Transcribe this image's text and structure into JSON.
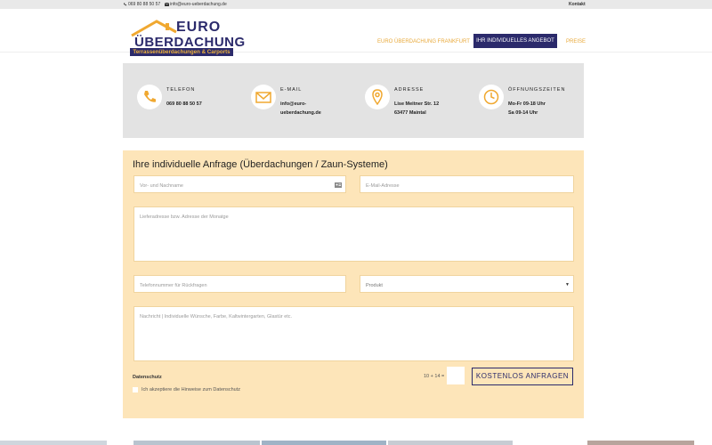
{
  "topbar": {
    "phone": "069 80 88 50 57",
    "email": "info@euro-ueberdachung.de",
    "contact_link": "Kontakt"
  },
  "logo": {
    "line1": "EURO",
    "line2": "ÜBERDACHUNG",
    "tagline": "Terrassenüberdachungen & Carports"
  },
  "nav": {
    "item1": "EURO ÜBERDACHUNG FRANKFURT",
    "item2": "IHR INDIVIDUELLES ANGEBOT",
    "item3": "PREISE"
  },
  "contact": {
    "phone_title": "TELEFON",
    "phone_value": "069 80 88 50 57",
    "email_title": "E-MAIL",
    "email_line1": "info@euro-",
    "email_line2": "ueberdachung.de",
    "address_title": "ADRESSE",
    "address_line1": "Lise Meitner Str. 12",
    "address_line2": "63477 Maintal",
    "hours_title": "ÖFFNUNGSZEITEN",
    "hours_line1": "Mo-Fr 09-18 Uhr",
    "hours_line2": "Sa 09-14 Uhr"
  },
  "form": {
    "title": "Ihre individuelle Anfrage (Überdachungen / Zaun-Systeme)",
    "name_placeholder": "Vor- und Nachname",
    "email_placeholder": "E-Mail-Adresse",
    "address_placeholder": "Lieferadresse bzw. Adresse der Monatge",
    "phone_placeholder": "Telefonnummer für Rückfragen",
    "product_selected": "Produkt",
    "message_placeholder": "Nachricht | Individuelle Wünsche, Farbe, Kaltwintergarten, Glastür etc.",
    "privacy_label": "Datenschutz",
    "privacy_checkbox": "Ich akzeptiere die Hinweise zum Datenschutz",
    "captcha": "10 + 14 =",
    "submit": "KOSTENLOS ANFRAGEN"
  },
  "colors": {
    "brand_navy": "#2b2a6b",
    "accent_orange": "#e8a93a",
    "form_bg": "#fde5b9",
    "contact_bg": "#e3e3e3"
  }
}
